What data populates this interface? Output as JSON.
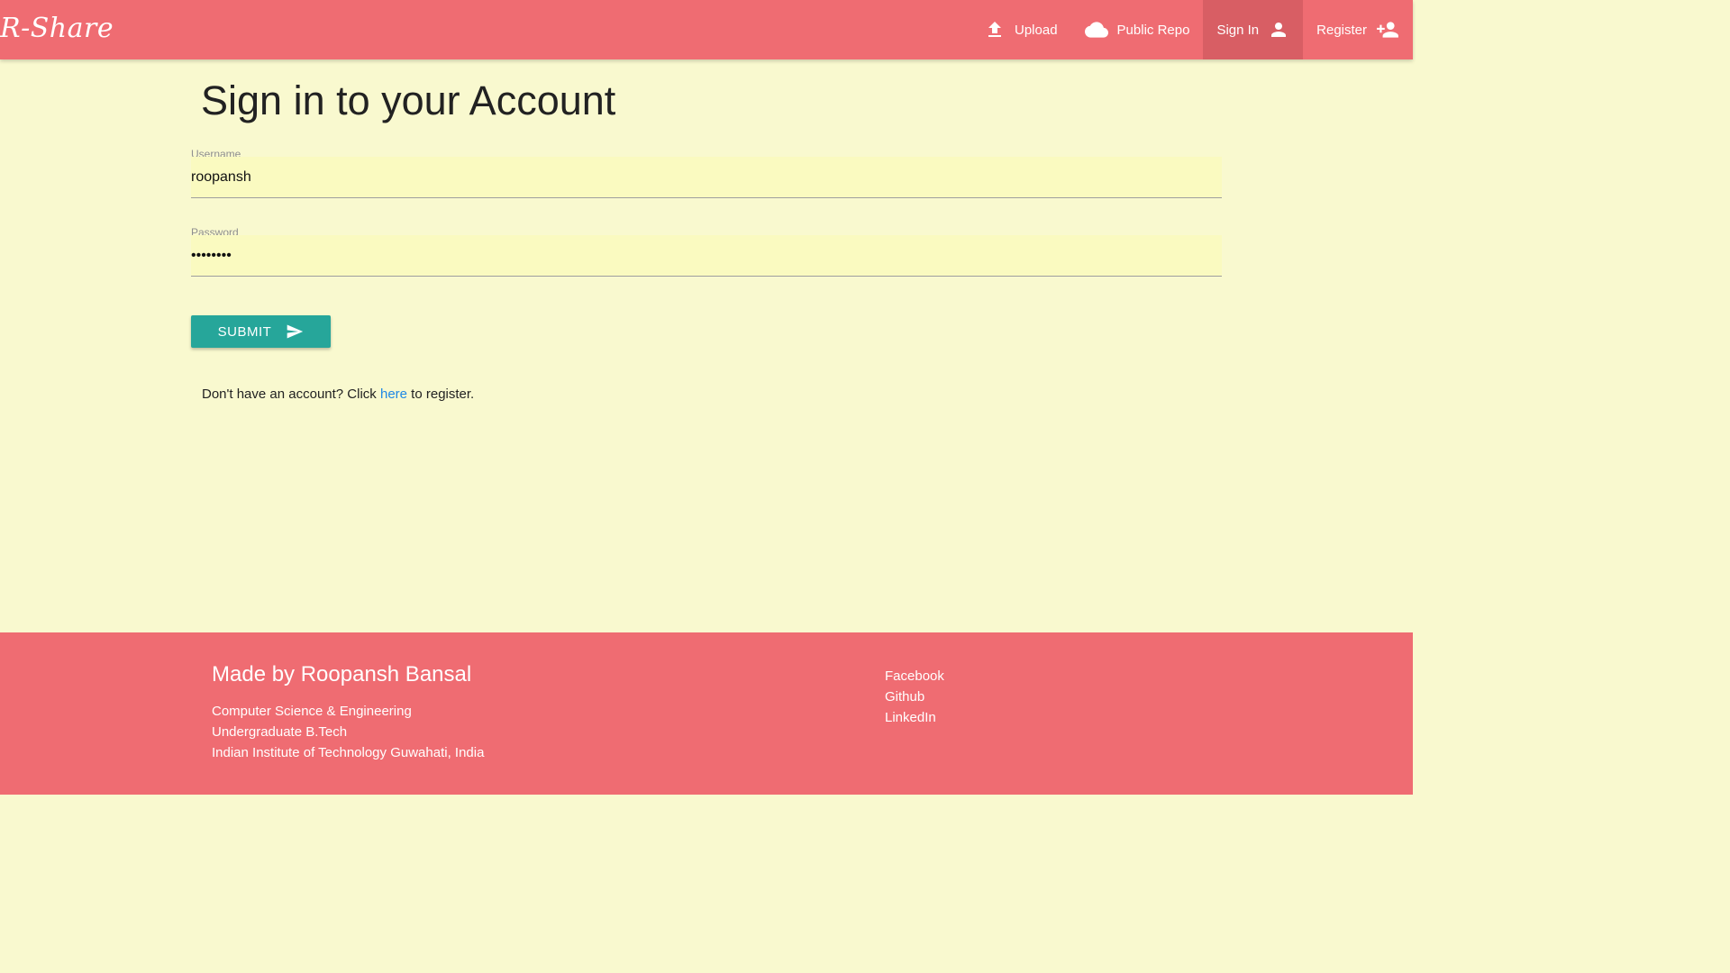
{
  "brand": "R-Share",
  "nav": {
    "upload": {
      "label": "Upload",
      "icon": "upload-icon"
    },
    "public_repo": {
      "label": "Public Repo",
      "icon": "cloud-icon"
    },
    "sign_in": {
      "label": "Sign In",
      "icon": "person-icon",
      "active": true
    },
    "register": {
      "label": "Register",
      "icon": "person-add-icon"
    }
  },
  "page": {
    "title": "Sign in to your Account"
  },
  "form": {
    "username": {
      "label": "Username",
      "value": "roopansh"
    },
    "password": {
      "label": "Password",
      "value": "••••••••"
    },
    "submit_label": "SUBMIT",
    "submit_icon": "send-icon"
  },
  "register_prompt": {
    "before": "Don't have an account? Click ",
    "link": "here",
    "after": " to register."
  },
  "footer": {
    "title": "Made by Roopansh Bansal",
    "lines": [
      "Computer Science & Engineering",
      "Undergraduate B.Tech",
      "Indian Institute of Technology Guwahati, India"
    ],
    "links": [
      "Facebook",
      "Github",
      "LinkedIn"
    ]
  },
  "colors": {
    "nav_bg": "#ef6c72",
    "nav_active": "#d85e64",
    "page_bg": "#f9f9cf",
    "input_bg": "#fafac0",
    "button": "#26a69a",
    "link": "#1e88e5"
  }
}
